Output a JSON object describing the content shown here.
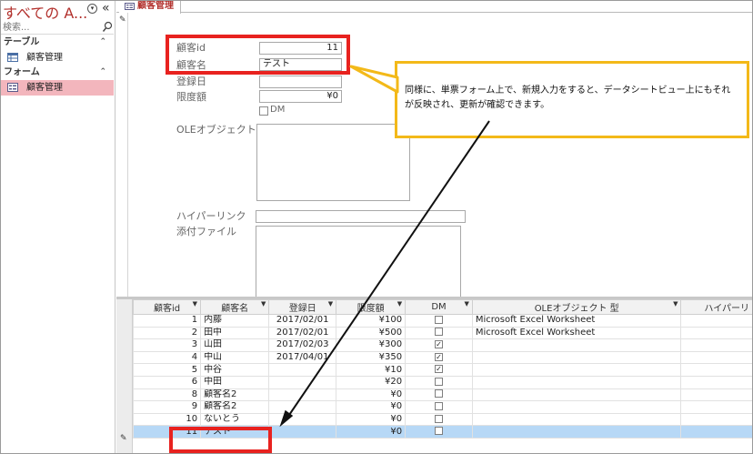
{
  "nav": {
    "title": "すべての A...",
    "search_placeholder": "検索...",
    "groups": [
      {
        "label": "テーブル",
        "items": [
          {
            "label": "顧客管理"
          }
        ]
      },
      {
        "label": "フォーム",
        "items": [
          {
            "label": "顧客管理"
          }
        ]
      }
    ]
  },
  "document": {
    "tab_label": "顧客管理"
  },
  "form": {
    "fields": {
      "id": {
        "label": "顧客id",
        "value": "11"
      },
      "name": {
        "label": "顧客名",
        "value": "テスト"
      },
      "date": {
        "label": "登録日",
        "value": ""
      },
      "limit": {
        "label": "限度額",
        "value": "¥0"
      },
      "dm": {
        "label": "DM",
        "checked": false
      },
      "ole": {
        "label": "OLEオブジェクト 型"
      },
      "hyperlink": {
        "label": "ハイパーリンク",
        "value": ""
      },
      "attachment": {
        "label": "添付ファイル"
      }
    }
  },
  "datasheet": {
    "columns": [
      "顧客id",
      "顧客名",
      "登録日",
      "限度額",
      "DM",
      "OLEオブジェクト 型",
      "ハイパーリ"
    ],
    "rows": [
      {
        "id": "1",
        "name": "内藤",
        "date": "2017/02/01",
        "limit": "¥100",
        "dm": false,
        "ole": "Microsoft Excel Worksheet"
      },
      {
        "id": "2",
        "name": "田中",
        "date": "2017/02/01",
        "limit": "¥500",
        "dm": false,
        "ole": "Microsoft Excel Worksheet"
      },
      {
        "id": "3",
        "name": "山田",
        "date": "2017/02/03",
        "limit": "¥300",
        "dm": true,
        "ole": ""
      },
      {
        "id": "4",
        "name": "中山",
        "date": "2017/04/01",
        "limit": "¥350",
        "dm": true,
        "ole": ""
      },
      {
        "id": "5",
        "name": "中谷",
        "date": "",
        "limit": "¥10",
        "dm": true,
        "ole": ""
      },
      {
        "id": "6",
        "name": "中田",
        "date": "",
        "limit": "¥20",
        "dm": false,
        "ole": ""
      },
      {
        "id": "8",
        "name": "顧客名2",
        "date": "",
        "limit": "¥0",
        "dm": false,
        "ole": ""
      },
      {
        "id": "9",
        "name": "顧客名2",
        "date": "",
        "limit": "¥0",
        "dm": false,
        "ole": ""
      },
      {
        "id": "10",
        "name": "ないとう",
        "date": "",
        "limit": "¥0",
        "dm": false,
        "ole": ""
      },
      {
        "id": "11",
        "name": "テスト",
        "date": "",
        "limit": "¥0",
        "dm": false,
        "ole": "",
        "selected": true
      }
    ]
  },
  "callout": {
    "text": "同様に、単票フォーム上で、新規入力をすると、データシートビュー上にもそれが反映され、更新が確認できます。"
  },
  "colors": {
    "highlight_red": "#e8221f",
    "callout_border": "#f3b919",
    "nav_selected": "#f3b6bd",
    "row_selected": "#b7d8f6",
    "title_red": "#b2302c"
  }
}
